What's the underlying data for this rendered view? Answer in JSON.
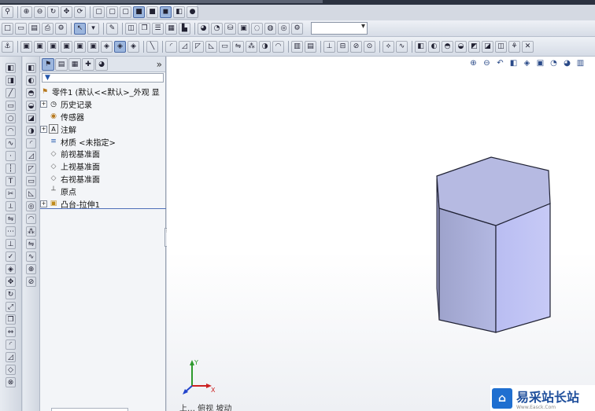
{
  "feature_manager": {
    "more_label": "»",
    "root": "零件1 (默认<<默认>_外观 显",
    "items": [
      {
        "label": "历史记录",
        "expandable": true,
        "icon": "history-icon",
        "icon_glyph": "◷"
      },
      {
        "label": "传感器",
        "expandable": false,
        "icon": "sensor-icon",
        "icon_glyph": "◉"
      },
      {
        "label": "注解",
        "expandable": true,
        "icon": "annotation-icon",
        "icon_glyph": "A"
      },
      {
        "label": "材质 <未指定>",
        "expandable": false,
        "icon": "material-icon",
        "icon_glyph": "≡"
      },
      {
        "label": "前视基准面",
        "expandable": false,
        "icon": "plane-icon",
        "icon_glyph": "◇"
      },
      {
        "label": "上视基准面",
        "expandable": false,
        "icon": "plane-icon",
        "icon_glyph": "◇"
      },
      {
        "label": "右视基准面",
        "expandable": false,
        "icon": "plane-icon",
        "icon_glyph": "◇"
      },
      {
        "label": "原点",
        "expandable": false,
        "icon": "origin-icon",
        "icon_glyph": "┴"
      },
      {
        "label": "凸台-拉伸1",
        "expandable": true,
        "icon": "extrude-boss-icon",
        "icon_glyph": "▣"
      }
    ]
  },
  "viewport": {
    "status_hint": "上… 俯视 坡动",
    "triad": {
      "x": "X",
      "y": "Y"
    }
  },
  "watermark": {
    "logo": "⌂",
    "name": "易采站长站",
    "url": "Www.Easck.Com"
  },
  "colors": {
    "model_top": "#b9bee0",
    "model_left": "#a8acd5",
    "model_right": "#c2c6f0",
    "accent": "#4f6fb8"
  }
}
